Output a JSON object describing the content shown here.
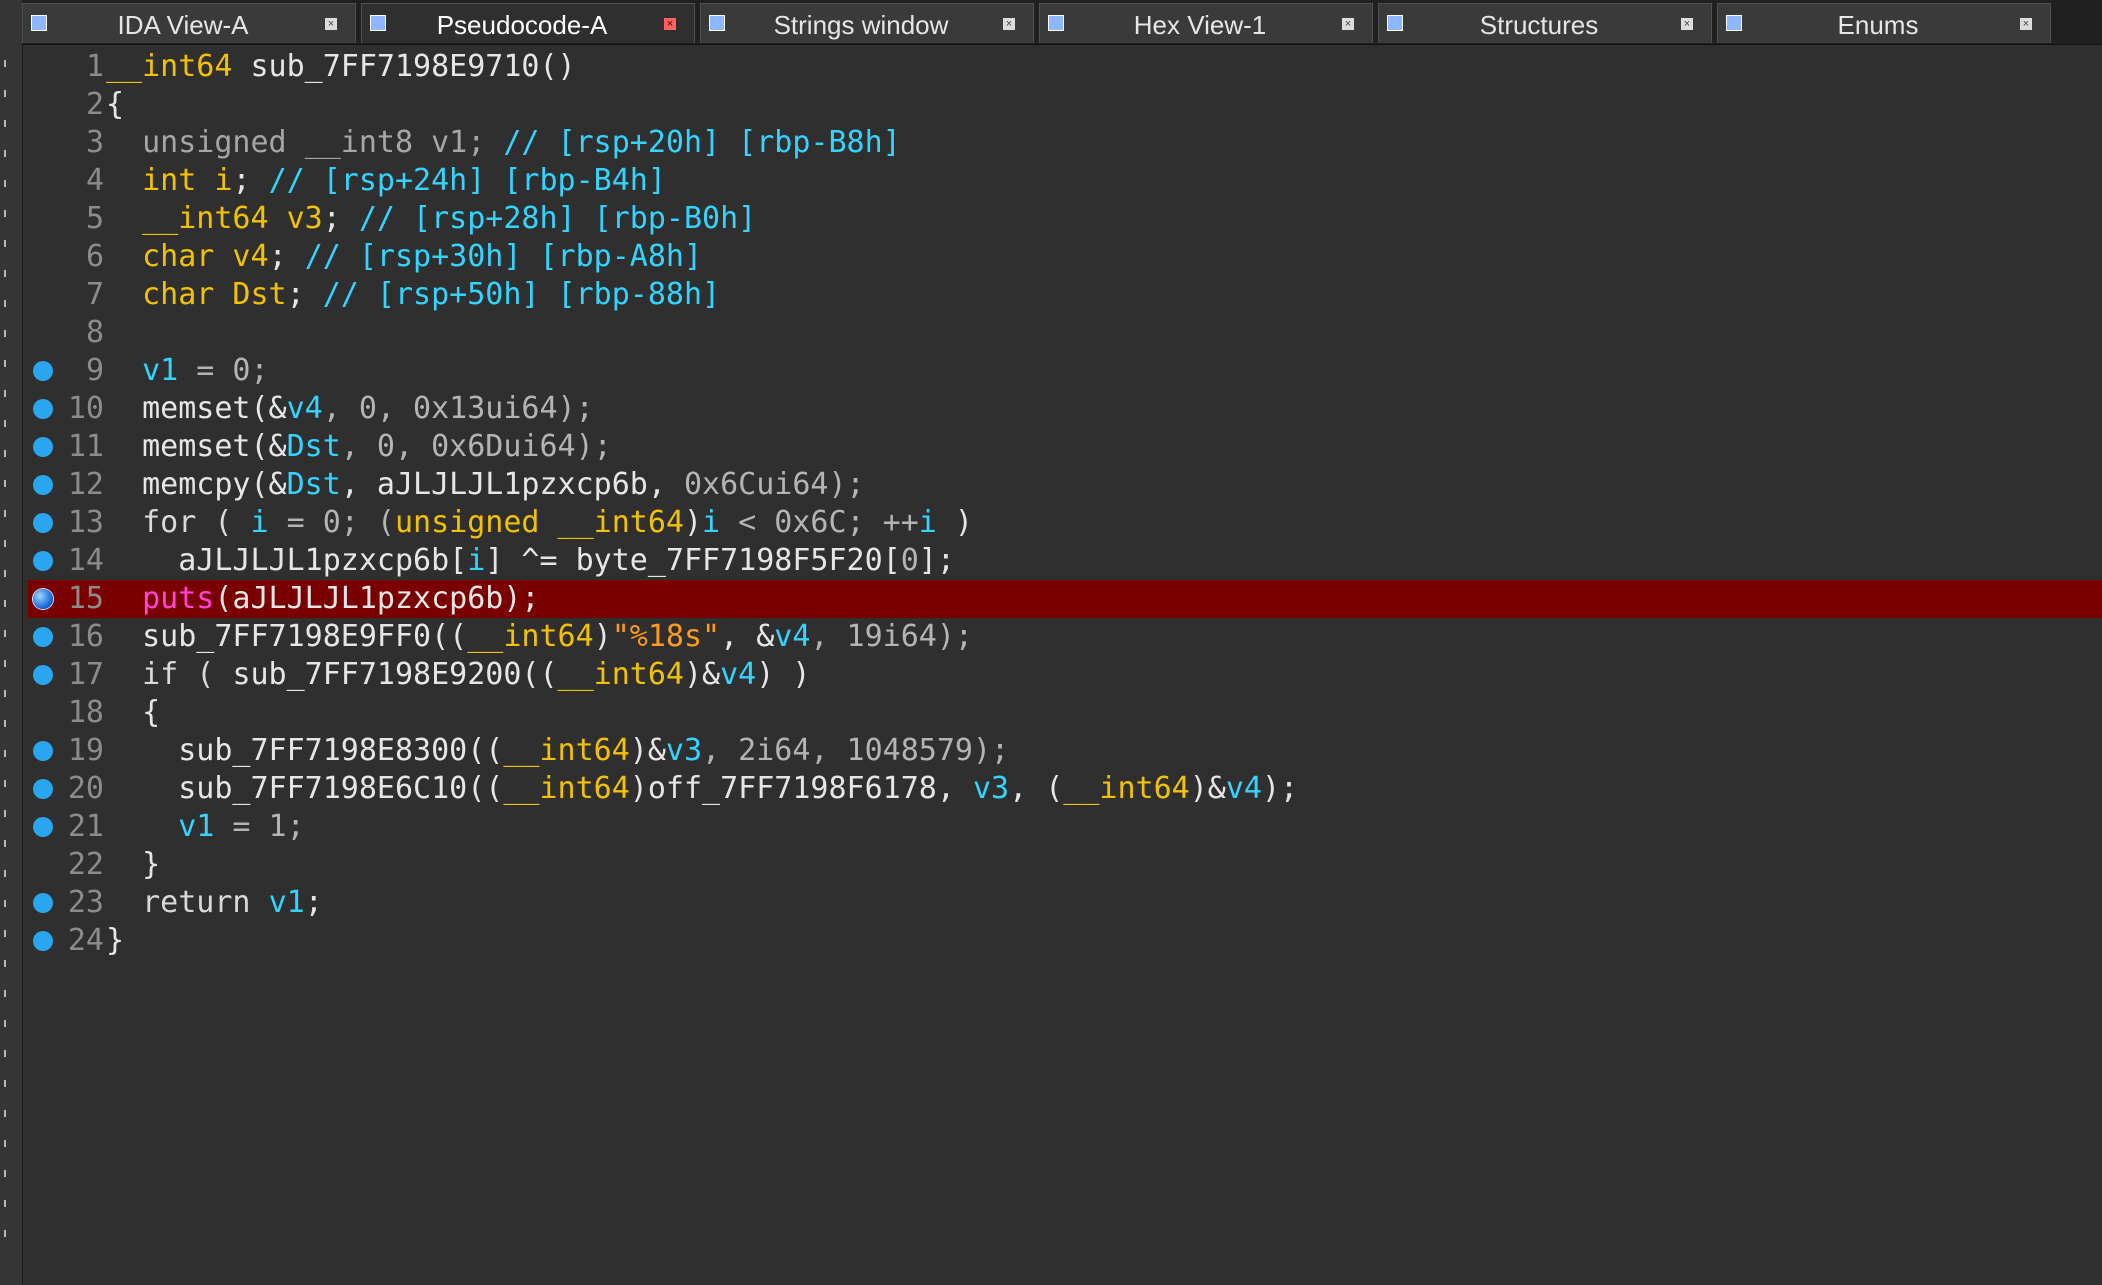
{
  "tabs": [
    {
      "label": "IDA View-A",
      "icon": "ida-view-icon",
      "active": false
    },
    {
      "label": "Pseudocode-A",
      "icon": "pseudocode-icon",
      "active": true
    },
    {
      "label": "Strings window",
      "icon": "strings-icon",
      "active": false
    },
    {
      "label": "Hex View-1",
      "icon": "hex-view-icon",
      "active": false
    },
    {
      "label": "Structures",
      "icon": "structures-icon",
      "active": false
    },
    {
      "label": "Enums",
      "icon": "enums-icon",
      "active": false
    }
  ],
  "colors": {
    "background": "#2f2f2f",
    "highlight": "#7a0000",
    "breakpoint": "#2aa6f0",
    "keyword_type": "#f2c200",
    "variable": "#33d4ff",
    "string": "#ff9a1a",
    "import": "#ff42d8"
  },
  "code": {
    "highlighted_line": 15,
    "lines": [
      {
        "n": "1",
        "bp": "none",
        "tokens": [
          [
            "type",
            "__int64"
          ],
          [
            "fn",
            " sub_7FF7198E9710()"
          ]
        ]
      },
      {
        "n": "2",
        "bp": "none",
        "tokens": [
          [
            "pun",
            "{"
          ]
        ]
      },
      {
        "n": "3",
        "bp": "none",
        "tokens": [
          [
            "gray",
            "  unsigned __int8 v1; "
          ],
          [
            "cmt",
            "// [rsp+20h] [rbp-B8h]"
          ]
        ]
      },
      {
        "n": "4",
        "bp": "none",
        "tokens": [
          [
            "type",
            "  int i"
          ],
          [
            "pun",
            "; "
          ],
          [
            "cmt",
            "// [rsp+24h] [rbp-B4h]"
          ]
        ]
      },
      {
        "n": "5",
        "bp": "none",
        "tokens": [
          [
            "type",
            "  __int64 v3"
          ],
          [
            "pun",
            "; "
          ],
          [
            "cmt",
            "// [rsp+28h] [rbp-B0h]"
          ]
        ]
      },
      {
        "n": "6",
        "bp": "none",
        "tokens": [
          [
            "type",
            "  char v4"
          ],
          [
            "pun",
            "; "
          ],
          [
            "cmt",
            "// [rsp+30h] [rbp-A8h]"
          ]
        ]
      },
      {
        "n": "7",
        "bp": "none",
        "tokens": [
          [
            "type",
            "  char Dst"
          ],
          [
            "pun",
            "; "
          ],
          [
            "cmt",
            "// [rsp+50h] [rbp-88h]"
          ]
        ]
      },
      {
        "n": "8",
        "bp": "none",
        "tokens": []
      },
      {
        "n": "9",
        "bp": "set",
        "tokens": [
          [
            "pun",
            "  "
          ],
          [
            "var",
            "v1"
          ],
          [
            "num",
            " = 0;"
          ]
        ]
      },
      {
        "n": "10",
        "bp": "set",
        "tokens": [
          [
            "fn",
            "  memset(&"
          ],
          [
            "var",
            "v4"
          ],
          [
            "num",
            ", 0, 0x13ui64);"
          ]
        ]
      },
      {
        "n": "11",
        "bp": "set",
        "tokens": [
          [
            "fn",
            "  memset(&"
          ],
          [
            "var",
            "Dst"
          ],
          [
            "num",
            ", 0, 0x6Dui64);"
          ]
        ]
      },
      {
        "n": "12",
        "bp": "set",
        "tokens": [
          [
            "fn",
            "  memcpy(&"
          ],
          [
            "var",
            "Dst"
          ],
          [
            "fn",
            ", aJLJLJL1pzxcp6b, "
          ],
          [
            "num",
            "0x6Cui64);"
          ]
        ]
      },
      {
        "n": "13",
        "bp": "set",
        "tokens": [
          [
            "kw",
            "  for ( "
          ],
          [
            "var",
            "i"
          ],
          [
            "num",
            " = 0; ("
          ],
          [
            "type",
            "unsigned __int64"
          ],
          [
            "pun",
            ")"
          ],
          [
            "var",
            "i"
          ],
          [
            "num",
            " < 0x6C; ++"
          ],
          [
            "var",
            "i"
          ],
          [
            "pun",
            " )"
          ]
        ]
      },
      {
        "n": "14",
        "bp": "set",
        "tokens": [
          [
            "fn",
            "    aJLJLJL1pzxcp6b["
          ],
          [
            "var",
            "i"
          ],
          [
            "fn",
            "] ^= byte_7FF7198F5F20["
          ],
          [
            "num",
            "0"
          ],
          [
            "fn",
            "];"
          ]
        ]
      },
      {
        "n": "15",
        "bp": "current",
        "tokens": [
          [
            "pun",
            "  "
          ],
          [
            "imp",
            "puts"
          ],
          [
            "fn",
            "(aJLJLJL1pzxcp6b);"
          ]
        ]
      },
      {
        "n": "16",
        "bp": "set",
        "tokens": [
          [
            "fn",
            "  sub_7FF7198E9FF0(("
          ],
          [
            "type",
            "__int64"
          ],
          [
            "pun",
            ")"
          ],
          [
            "str",
            "\"%18s\""
          ],
          [
            "pun",
            ", &"
          ],
          [
            "var",
            "v4"
          ],
          [
            "num",
            ", 19i64);"
          ]
        ]
      },
      {
        "n": "17",
        "bp": "set",
        "tokens": [
          [
            "kw",
            "  if ( "
          ],
          [
            "fn",
            "sub_7FF7198E9200(("
          ],
          [
            "type",
            "__int64"
          ],
          [
            "pun",
            ")&"
          ],
          [
            "var",
            "v4"
          ],
          [
            "pun",
            ") )"
          ]
        ]
      },
      {
        "n": "18",
        "bp": "none",
        "tokens": [
          [
            "pun",
            "  {"
          ]
        ]
      },
      {
        "n": "19",
        "bp": "set",
        "tokens": [
          [
            "fn",
            "    sub_7FF7198E8300(("
          ],
          [
            "type",
            "__int64"
          ],
          [
            "pun",
            ")&"
          ],
          [
            "var",
            "v3"
          ],
          [
            "num",
            ", 2i64, 1048579);"
          ]
        ]
      },
      {
        "n": "20",
        "bp": "set",
        "tokens": [
          [
            "fn",
            "    sub_7FF7198E6C10(("
          ],
          [
            "type",
            "__int64"
          ],
          [
            "fn",
            ")off_7FF7198F6178, "
          ],
          [
            "var",
            "v3"
          ],
          [
            "pun",
            ", ("
          ],
          [
            "type",
            "__int64"
          ],
          [
            "pun",
            ")&"
          ],
          [
            "var",
            "v4"
          ],
          [
            "pun",
            ");"
          ]
        ]
      },
      {
        "n": "21",
        "bp": "set",
        "tokens": [
          [
            "pun",
            "    "
          ],
          [
            "var",
            "v1"
          ],
          [
            "num",
            " = 1;"
          ]
        ]
      },
      {
        "n": "22",
        "bp": "none",
        "tokens": [
          [
            "pun",
            "  }"
          ]
        ]
      },
      {
        "n": "23",
        "bp": "set",
        "tokens": [
          [
            "kw",
            "  return "
          ],
          [
            "var",
            "v1"
          ],
          [
            "pun",
            ";"
          ]
        ]
      },
      {
        "n": "24",
        "bp": "set",
        "tokens": [
          [
            "pun",
            "}"
          ]
        ]
      }
    ]
  }
}
